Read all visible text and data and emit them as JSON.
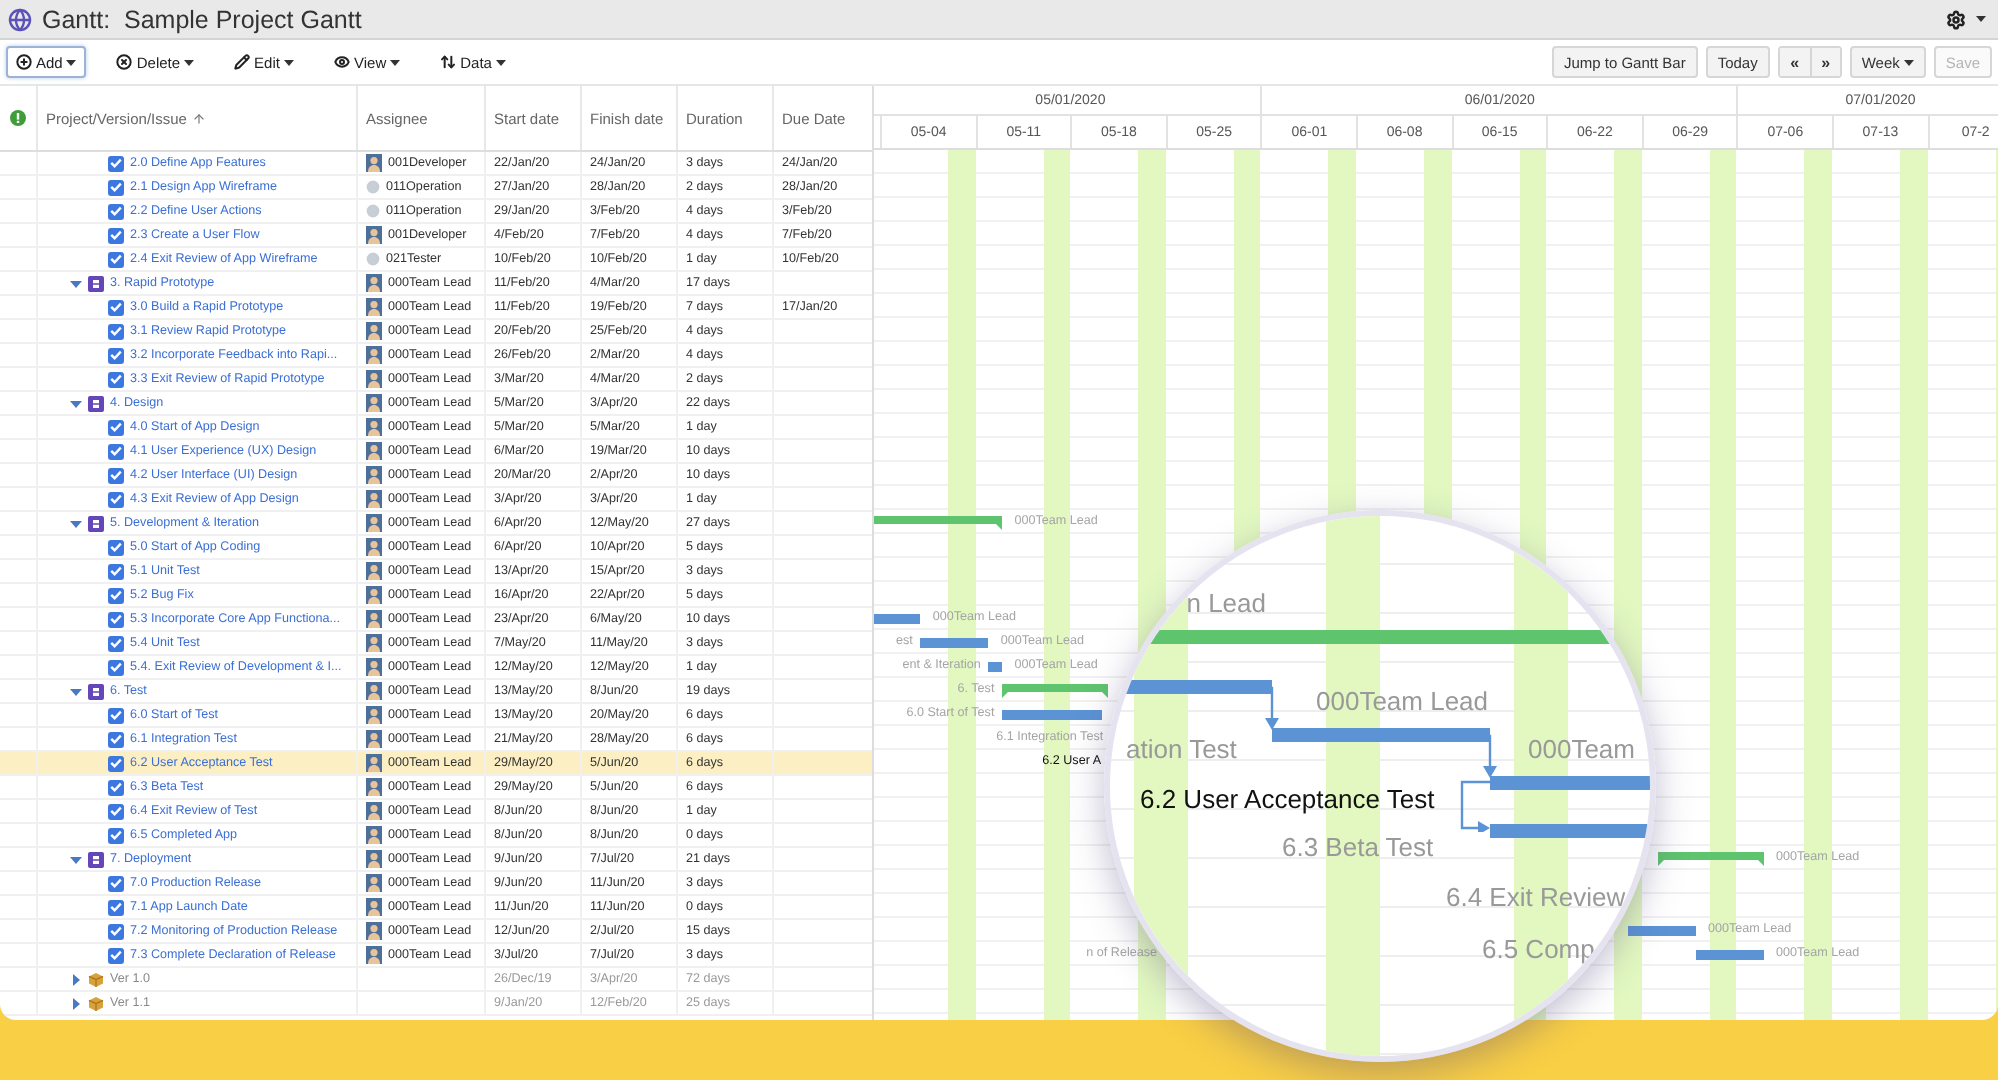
{
  "window": {
    "title": "Gantt:  Sample Project Gantt"
  },
  "toolbar": {
    "buttons": [
      {
        "label": "Add",
        "focused": true
      },
      {
        "label": "Delete",
        "focused": false
      },
      {
        "label": "Edit",
        "focused": false
      },
      {
        "label": "View",
        "focused": false
      },
      {
        "label": "Data",
        "focused": false
      }
    ],
    "right_buttons": [
      {
        "label": "Jump to Gantt Bar",
        "disabled": false
      },
      {
        "label": "Today",
        "disabled": false
      }
    ],
    "nav": [
      "«",
      "»"
    ],
    "scale": "Week",
    "save": {
      "label": "Save",
      "disabled": true
    }
  },
  "table": {
    "columns": [
      "Project/Version/Issue",
      "Assignee",
      "Start date",
      "Finish date",
      "Duration",
      "Due Date"
    ],
    "rows": [
      {
        "kind": "task",
        "name": "2.0 Define App Features",
        "checked": true,
        "assignee": "001Developer",
        "avatar": {
          "kind": "photo"
        },
        "start": "22/Jan/20",
        "finish": "24/Jan/20",
        "duration": "3 days",
        "due": "24/Jan/20",
        "selected": false
      },
      {
        "kind": "task",
        "name": "2.1 Design App Wireframe",
        "checked": true,
        "assignee": "011Operation",
        "avatar": {
          "kind": "round"
        },
        "start": "27/Jan/20",
        "finish": "28/Jan/20",
        "duration": "2 days",
        "due": "28/Jan/20",
        "selected": false
      },
      {
        "kind": "task",
        "name": "2.2 Define User Actions",
        "checked": true,
        "assignee": "011Operation",
        "avatar": {
          "kind": "round"
        },
        "start": "29/Jan/20",
        "finish": "3/Feb/20",
        "duration": "4 days",
        "due": "3/Feb/20",
        "selected": false
      },
      {
        "kind": "task",
        "name": "2.3 Create a User Flow",
        "checked": true,
        "assignee": "001Developer",
        "avatar": {
          "kind": "photo"
        },
        "start": "4/Feb/20",
        "finish": "7/Feb/20",
        "duration": "4 days",
        "due": "7/Feb/20",
        "selected": false
      },
      {
        "kind": "task",
        "name": "2.4 Exit Review of App Wireframe",
        "checked": true,
        "assignee": "021Tester",
        "avatar": {
          "kind": "round"
        },
        "start": "10/Feb/20",
        "finish": "10/Feb/20",
        "duration": "1 day",
        "due": "10/Feb/20",
        "selected": false
      },
      {
        "kind": "group",
        "name": "3. Rapid Prototype",
        "expanded": true,
        "assignee": "000Team Lead",
        "avatar": {
          "kind": "photo"
        },
        "start": "11/Feb/20",
        "finish": "4/Mar/20",
        "duration": "17 days",
        "selected": false
      },
      {
        "kind": "task",
        "name": "3.0 Build a Rapid Prototype",
        "checked": true,
        "assignee": "000Team Lead",
        "avatar": {
          "kind": "photo"
        },
        "start": "11/Feb/20",
        "finish": "19/Feb/20",
        "duration": "7 days",
        "due": "17/Jan/20",
        "selected": false
      },
      {
        "kind": "task",
        "name": "3.1 Review Rapid Prototype",
        "checked": true,
        "assignee": "000Team Lead",
        "avatar": {
          "kind": "photo"
        },
        "start": "20/Feb/20",
        "finish": "25/Feb/20",
        "duration": "4 days",
        "selected": false
      },
      {
        "kind": "task",
        "name": "3.2 Incorporate Feedback into Rapi...",
        "checked": true,
        "assignee": "000Team Lead",
        "avatar": {
          "kind": "photo"
        },
        "start": "26/Feb/20",
        "finish": "2/Mar/20",
        "duration": "4 days",
        "selected": false
      },
      {
        "kind": "task",
        "name": "3.3 Exit Review of Rapid Prototype",
        "checked": true,
        "assignee": "000Team Lead",
        "avatar": {
          "kind": "photo"
        },
        "start": "3/Mar/20",
        "finish": "4/Mar/20",
        "duration": "2 days",
        "selected": false
      },
      {
        "kind": "group",
        "name": "4. Design",
        "expanded": true,
        "assignee": "000Team Lead",
        "avatar": {
          "kind": "photo"
        },
        "start": "5/Mar/20",
        "finish": "3/Apr/20",
        "duration": "22 days",
        "selected": false
      },
      {
        "kind": "task",
        "name": "4.0 Start of App Design",
        "checked": true,
        "assignee": "000Team Lead",
        "avatar": {
          "kind": "photo"
        },
        "start": "5/Mar/20",
        "finish": "5/Mar/20",
        "duration": "1 day",
        "selected": false
      },
      {
        "kind": "task",
        "name": "4.1 User Experience (UX) Design",
        "checked": true,
        "assignee": "000Team Lead",
        "avatar": {
          "kind": "photo"
        },
        "start": "6/Mar/20",
        "finish": "19/Mar/20",
        "duration": "10 days",
        "selected": false
      },
      {
        "kind": "task",
        "name": "4.2 User Interface (UI) Design",
        "checked": true,
        "assignee": "000Team Lead",
        "avatar": {
          "kind": "photo"
        },
        "start": "20/Mar/20",
        "finish": "2/Apr/20",
        "duration": "10 days",
        "selected": false
      },
      {
        "kind": "task",
        "name": "4.3 Exit Review of App Design",
        "checked": true,
        "assignee": "000Team Lead",
        "avatar": {
          "kind": "photo"
        },
        "start": "3/Apr/20",
        "finish": "3/Apr/20",
        "duration": "1 day",
        "selected": false
      },
      {
        "kind": "group",
        "name": "5. Development & Iteration",
        "expanded": true,
        "assignee": "000Team Lead",
        "avatar": {
          "kind": "photo"
        },
        "start": "6/Apr/20",
        "finish": "12/May/20",
        "duration": "27 days",
        "selected": false,
        "bar_labels": [
          {
            "kind": "after",
            "text": "000Team Lead"
          }
        ]
      },
      {
        "kind": "task",
        "name": "5.0 Start of App Coding",
        "checked": true,
        "assignee": "000Team Lead",
        "avatar": {
          "kind": "photo"
        },
        "start": "6/Apr/20",
        "finish": "10/Apr/20",
        "duration": "5 days",
        "selected": false
      },
      {
        "kind": "task",
        "name": "5.1 Unit Test",
        "checked": true,
        "assignee": "000Team Lead",
        "avatar": {
          "kind": "photo"
        },
        "start": "13/Apr/20",
        "finish": "15/Apr/20",
        "duration": "3 days",
        "selected": false
      },
      {
        "kind": "task",
        "name": "5.2 Bug Fix",
        "checked": true,
        "assignee": "000Team Lead",
        "avatar": {
          "kind": "photo"
        },
        "start": "16/Apr/20",
        "finish": "22/Apr/20",
        "duration": "5 days",
        "selected": false
      },
      {
        "kind": "task",
        "name": "5.3 Incorporate Core App Functiona...",
        "checked": true,
        "assignee": "000Team Lead",
        "avatar": {
          "kind": "photo"
        },
        "start": "23/Apr/20",
        "finish": "6/May/20",
        "duration": "10 days",
        "selected": false,
        "bar_labels": [
          {
            "kind": "after",
            "text": "000Team Lead"
          }
        ]
      },
      {
        "kind": "task",
        "name": "5.4 Unit Test",
        "checked": true,
        "assignee": "000Team Lead",
        "avatar": {
          "kind": "photo"
        },
        "start": "7/May/20",
        "finish": "11/May/20",
        "duration": "3 days",
        "selected": false,
        "bar_labels": [
          {
            "kind": "before",
            "text": "est"
          },
          {
            "kind": "after",
            "text": "000Team Lead"
          }
        ]
      },
      {
        "kind": "task",
        "name": "5.4. Exit Review of Development & I...",
        "checked": true,
        "assignee": "000Team Lead",
        "avatar": {
          "kind": "photo"
        },
        "start": "12/May/20",
        "finish": "12/May/20",
        "duration": "1 day",
        "selected": false,
        "bar_labels": [
          {
            "kind": "before",
            "text": "ent & Iteration"
          },
          {
            "kind": "after",
            "text": "000Team Lead"
          }
        ]
      },
      {
        "kind": "group",
        "name": "6. Test",
        "expanded": true,
        "assignee": "000Team Lead",
        "avatar": {
          "kind": "photo"
        },
        "start": "13/May/20",
        "finish": "8/Jun/20",
        "duration": "19 days",
        "selected": false,
        "bar_labels": [
          {
            "kind": "before",
            "text": "6. Test"
          }
        ]
      },
      {
        "kind": "task",
        "name": "6.0 Start of Test",
        "checked": true,
        "assignee": "000Team Lead",
        "avatar": {
          "kind": "photo"
        },
        "start": "13/May/20",
        "finish": "20/May/20",
        "duration": "6 days",
        "selected": false,
        "bar_labels": [
          {
            "kind": "before",
            "text": "6.0 Start of Test"
          }
        ]
      },
      {
        "kind": "task",
        "name": "6.1 Integration Test",
        "checked": true,
        "assignee": "000Team Lead",
        "avatar": {
          "kind": "photo"
        },
        "start": "21/May/20",
        "finish": "28/May/20",
        "duration": "6 days",
        "selected": false,
        "bar_labels": [
          {
            "kind": "before",
            "text": "6.1 Integration Test"
          }
        ]
      },
      {
        "kind": "task",
        "name": "6.2 User Acceptance Test",
        "checked": true,
        "assignee": "000Team Lead",
        "avatar": {
          "kind": "photo"
        },
        "start": "29/May/20",
        "finish": "5/Jun/20",
        "duration": "6 days",
        "selected": true,
        "bar_labels": [
          {
            "kind": "before",
            "text": "6.2 User A"
          }
        ]
      },
      {
        "kind": "task",
        "name": "6.3 Beta Test",
        "checked": true,
        "assignee": "000Team Lead",
        "avatar": {
          "kind": "photo"
        },
        "start": "29/May/20",
        "finish": "5/Jun/20",
        "duration": "6 days",
        "selected": false
      },
      {
        "kind": "task",
        "name": "6.4 Exit Review of Test",
        "checked": true,
        "assignee": "000Team Lead",
        "avatar": {
          "kind": "photo"
        },
        "start": "8/Jun/20",
        "finish": "8/Jun/20",
        "duration": "1 day",
        "selected": false
      },
      {
        "kind": "task",
        "name": "6.5 Completed App",
        "checked": true,
        "assignee": "000Team Lead",
        "avatar": {
          "kind": "photo"
        },
        "start": "8/Jun/20",
        "finish": "8/Jun/20",
        "duration": "0 days",
        "selected": false
      },
      {
        "kind": "group",
        "name": "7. Deployment",
        "expanded": true,
        "assignee": "000Team Lead",
        "avatar": {
          "kind": "photo"
        },
        "start": "9/Jun/20",
        "finish": "7/Jul/20",
        "duration": "21 days",
        "selected": false,
        "bar_labels": [
          {
            "kind": "after",
            "text": "000Team Lead"
          }
        ]
      },
      {
        "kind": "task",
        "name": "7.0 Production Release",
        "checked": true,
        "assignee": "000Team Lead",
        "avatar": {
          "kind": "photo"
        },
        "start": "9/Jun/20",
        "finish": "11/Jun/20",
        "duration": "3 days",
        "selected": false
      },
      {
        "kind": "task",
        "name": "7.1 App Launch Date",
        "checked": true,
        "assignee": "000Team Lead",
        "avatar": {
          "kind": "photo"
        },
        "start": "11/Jun/20",
        "finish": "11/Jun/20",
        "duration": "0 days",
        "selected": false
      },
      {
        "kind": "task",
        "name": "7.2 Monitoring of Production Release",
        "checked": true,
        "assignee": "000Team Lead",
        "avatar": {
          "kind": "photo"
        },
        "start": "12/Jun/20",
        "finish": "2/Jul/20",
        "duration": "15 days",
        "selected": false,
        "bar_labels": [
          {
            "kind": "after",
            "text": "000Team Lead"
          }
        ]
      },
      {
        "kind": "task",
        "name": "7.3 Complete Declaration of Release",
        "checked": true,
        "assignee": "000Team Lead",
        "avatar": {
          "kind": "photo"
        },
        "start": "3/Jul/20",
        "finish": "7/Jul/20",
        "duration": "3 days",
        "selected": false,
        "bar_labels": [
          {
            "kind": "before",
            "text": "n of Release"
          },
          {
            "kind": "after",
            "text": "000Team Lead"
          }
        ]
      },
      {
        "kind": "version",
        "name": "Ver 1.0",
        "expanded": false,
        "start": "26/Dec/19",
        "finish": "3/Apr/20",
        "duration": "72 days",
        "selected": false
      },
      {
        "kind": "version",
        "name": "Ver 1.1",
        "expanded": false,
        "start": "9/Jan/20",
        "finish": "12/Feb/20",
        "duration": "25 days",
        "selected": false
      }
    ]
  },
  "gantt": {
    "months": [
      "05/01/2020",
      "06/01/2020",
      "07/01/2020"
    ],
    "weeks": [
      "05-04",
      "05-11",
      "05-18",
      "05-25",
      "06-01",
      "06-08",
      "06-15",
      "06-22",
      "06-29",
      "07-06",
      "07-13",
      "07-2"
    ]
  },
  "magnifier": {
    "labels": [
      {
        "text": "n Lead",
        "highlighted": false
      },
      {
        "text": "000Team Lead",
        "highlighted": false
      },
      {
        "text": "ation Test",
        "highlighted": false
      },
      {
        "text": "000Team",
        "highlighted": false
      },
      {
        "text": "6.2 User Acceptance Test",
        "highlighted": true
      },
      {
        "text": "6.3 Beta Test",
        "highlighted": false
      },
      {
        "text": "6.4 Exit Review",
        "highlighted": false
      },
      {
        "text": "6.5 Comp",
        "highlighted": false
      }
    ]
  }
}
